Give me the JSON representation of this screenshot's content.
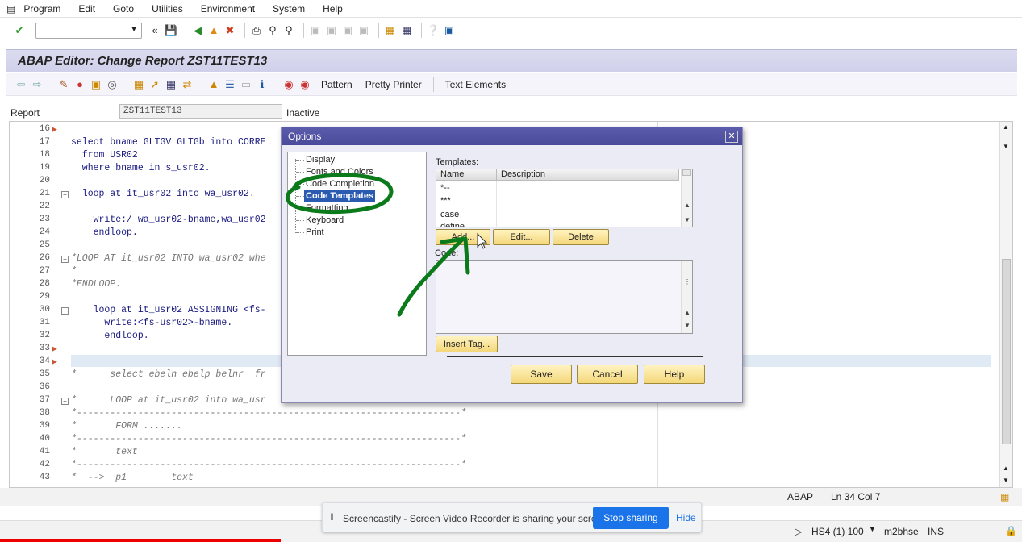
{
  "menu": {
    "items": [
      "Program",
      "Edit",
      "Goto",
      "Utilities",
      "Environment",
      "System",
      "Help"
    ]
  },
  "toolbar": {
    "command_field_value": ""
  },
  "title": "ABAP Editor: Change Report ZST11TEST13",
  "app_toolbar": {
    "pattern": "Pattern",
    "pretty_printer": "Pretty Printer",
    "text_elements": "Text Elements"
  },
  "report": {
    "label": "Report",
    "value": "ZST11TEST13",
    "status": "Inactive"
  },
  "editor": {
    "lines": [
      {
        "n": "16",
        "text": "",
        "fold": false,
        "comment": false
      },
      {
        "n": "17",
        "text": "select bname GLTGV GLTGb into CORRE",
        "fold": false,
        "comment": false
      },
      {
        "n": "18",
        "text": "  from USR02",
        "fold": false,
        "comment": false
      },
      {
        "n": "19",
        "text": "  where bname in s_usr02.",
        "fold": false,
        "comment": false
      },
      {
        "n": "20",
        "text": "",
        "fold": false,
        "comment": false
      },
      {
        "n": "21",
        "text": "  loop at it_usr02 into wa_usr02.",
        "fold": true,
        "comment": false
      },
      {
        "n": "22",
        "text": "",
        "fold": false,
        "comment": false
      },
      {
        "n": "23",
        "text": "    write:/ wa_usr02-bname,wa_usr02",
        "fold": false,
        "comment": false
      },
      {
        "n": "24",
        "text": "    endloop.",
        "fold": false,
        "comment": false
      },
      {
        "n": "25",
        "text": "",
        "fold": false,
        "comment": false
      },
      {
        "n": "26",
        "text": "*LOOP AT it_usr02 INTO wa_usr02 whe",
        "fold": true,
        "comment": true
      },
      {
        "n": "27",
        "text": "*",
        "fold": false,
        "comment": true
      },
      {
        "n": "28",
        "text": "*ENDLOOP.",
        "fold": false,
        "comment": true
      },
      {
        "n": "29",
        "text": "",
        "fold": false,
        "comment": false
      },
      {
        "n": "30",
        "text": "    loop at it_usr02 ASSIGNING <fs-",
        "fold": true,
        "comment": false
      },
      {
        "n": "31",
        "text": "      write:<fs-usr02>-bname.",
        "fold": false,
        "comment": false
      },
      {
        "n": "32",
        "text": "      endloop.",
        "fold": false,
        "comment": false
      },
      {
        "n": "33",
        "text": "",
        "fold": false,
        "comment": false
      },
      {
        "n": "34",
        "text": "",
        "fold": false,
        "comment": false
      },
      {
        "n": "35",
        "text": "*      select ebeln ebelp belnr  fr",
        "fold": false,
        "comment": true
      },
      {
        "n": "36",
        "text": "",
        "fold": false,
        "comment": false
      },
      {
        "n": "37",
        "text": "*      LOOP at it_usr02 into wa_usr",
        "fold": true,
        "comment": true
      },
      {
        "n": "38",
        "text": "*---------------------------------------------------------------------*",
        "fold": false,
        "comment": true
      },
      {
        "n": "39",
        "text": "*       FORM .......",
        "fold": false,
        "comment": true
      },
      {
        "n": "40",
        "text": "*---------------------------------------------------------------------*",
        "fold": false,
        "comment": true
      },
      {
        "n": "41",
        "text": "*       text",
        "fold": false,
        "comment": true
      },
      {
        "n": "42",
        "text": "*---------------------------------------------------------------------*",
        "fold": false,
        "comment": true
      },
      {
        "n": "43",
        "text": "*  -->  p1        text",
        "fold": false,
        "comment": true
      }
    ]
  },
  "status": {
    "lang": "ABAP",
    "position": "Ln  34 Col   7",
    "system": "HS4 (1) 100",
    "host": "m2bhse",
    "mode": "INS"
  },
  "share_banner": {
    "text": "Screencastify - Screen Video Recorder is sharing your screen.",
    "stop": "Stop sharing",
    "hide": "Hide"
  },
  "dialog": {
    "title": "Options",
    "tree": [
      "Display",
      "Fonts and Colors",
      "Code Completion",
      "Code Templates",
      "Formatting",
      "Keyboard",
      "Print"
    ],
    "selected": "Code Templates",
    "templates_label": "Templates:",
    "col_name": "Name",
    "col_desc": "Description",
    "rows": [
      "*--",
      "***",
      "case",
      "define"
    ],
    "add": "Add...",
    "edit": "Edit...",
    "delete": "Delete",
    "code_label": "Code:",
    "insert_tag": "Insert Tag...",
    "save": "Save",
    "cancel": "Cancel",
    "help": "Help"
  },
  "colors": {
    "title_bg": "#cfd0ea",
    "dialog_title": "#4a4a9a",
    "button": "#f4d77a",
    "annotation": "#0a7a1a",
    "share_button": "#1a73e8"
  }
}
